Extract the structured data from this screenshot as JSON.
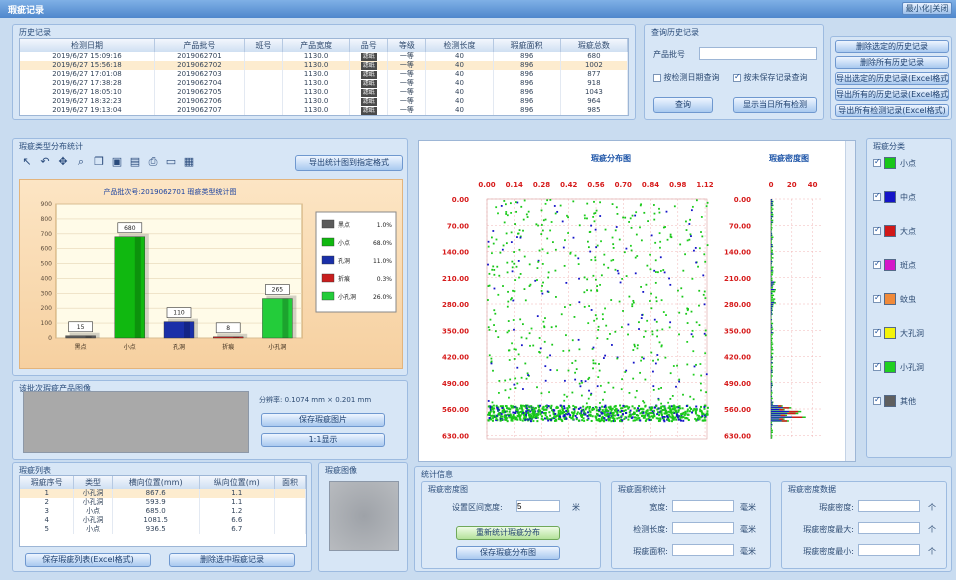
{
  "window": {
    "title": "瑕疵记录",
    "control_label": "最小化|关闭"
  },
  "history": {
    "title": "历史记录",
    "columns": [
      "检测日期",
      "产品批号",
      "班号",
      "产品宽度",
      "品号",
      "等级",
      "检测长度",
      "瑕疵面积",
      "瑕疵总数"
    ],
    "rows": [
      [
        "2019/6/27 15:09:16",
        "2019062701",
        "",
        "1130.0",
        "滤纸",
        "一等",
        "40",
        "896",
        "680"
      ],
      [
        "2019/6/27 15:56:18",
        "2019062702",
        "",
        "1130.0",
        "滤纸",
        "一等",
        "40",
        "896",
        "1002"
      ],
      [
        "2019/6/27 17:01:08",
        "2019062703",
        "",
        "1130.0",
        "滤纸",
        "一等",
        "40",
        "896",
        "877"
      ],
      [
        "2019/6/27 17:38:28",
        "2019062704",
        "",
        "1130.0",
        "滤纸",
        "一等",
        "40",
        "896",
        "918"
      ],
      [
        "2019/6/27 18:05:10",
        "2019062705",
        "",
        "1130.0",
        "滤纸",
        "一等",
        "40",
        "896",
        "1043"
      ],
      [
        "2019/6/27 18:32:23",
        "2019062706",
        "",
        "1130.0",
        "滤纸",
        "一等",
        "40",
        "896",
        "964"
      ],
      [
        "2019/6/27 19:13:04",
        "2019062707",
        "",
        "1130.0",
        "滤纸",
        "一等",
        "40",
        "896",
        "985"
      ]
    ]
  },
  "query": {
    "title": "查询历史记录",
    "batch_label": "产品批号",
    "batch_value": "",
    "check_date_label": "按检测日期查询",
    "check_unsaved_label": "按未保存记录查询",
    "query_button": "查询",
    "today_button": "显示当日所有检测"
  },
  "actions": [
    "删除选定的历史记录",
    "删除所有历史记录",
    "导出选定的历史记录(Excel格式)",
    "导出所有的历史记录(Excel格式)",
    "导出所有检测记录(Excel格式)"
  ],
  "stats": {
    "title": "瑕疵类型分布统计",
    "icons": [
      "pointer-icon",
      "undo-icon",
      "move-icon",
      "zoom-icon",
      "copy-icon",
      "save-icon",
      "grid-icon",
      "print-icon",
      "preview-icon",
      "export-icon"
    ],
    "icon_glyphs": [
      "↖",
      "↶",
      "✥",
      "⌕",
      "❐",
      "▣",
      "▤",
      "⎙",
      "▭",
      "▦"
    ],
    "export_button": "导出统计图到指定格式",
    "chart_title": "产品批次号:2019062701 瑕疵类型统计图",
    "legend_pct": [
      "1.0%",
      "68.0%",
      "11.0%",
      "0.3%",
      "26.0%"
    ]
  },
  "chart_data": [
    {
      "type": "bar",
      "title": "产品批次号:2019062701 瑕疵类型统计图",
      "categories": [
        "黑点",
        "小点",
        "孔洞",
        "折痕",
        "小孔洞"
      ],
      "values": [
        15,
        680,
        110,
        8,
        265
      ],
      "colors": [
        "#5a5a5a",
        "#10b810",
        "#1a2fa8",
        "#c81e1e",
        "#23cc3a"
      ],
      "ylim": [
        0,
        900
      ],
      "yticks": [
        0,
        100,
        200,
        300,
        400,
        500,
        600,
        700,
        800,
        900
      ],
      "data_labels": [
        "15",
        "680",
        "110",
        "8",
        "265"
      ]
    },
    {
      "type": "scatter",
      "title": "瑕疵分布图",
      "xticks": [
        "0.00",
        "0.14",
        "0.28",
        "0.42",
        "0.56",
        "0.70",
        "0.84",
        "0.98",
        "1.12"
      ],
      "yticks": [
        "0.00",
        "70.00",
        "140.00",
        "210.00",
        "280.00",
        "350.00",
        "420.00",
        "490.00",
        "560.00",
        "630.00"
      ],
      "xlim": [
        0,
        1.13
      ],
      "ylim": [
        0,
        640
      ],
      "dense_band": [
        548,
        590
      ]
    },
    {
      "type": "bar",
      "title": "瑕疵密度图",
      "xticks": [
        "0",
        "20",
        "40"
      ],
      "yticks": [
        "0.00",
        "70.00",
        "140.00",
        "210.00",
        "280.00",
        "350.00",
        "420.00",
        "490.00",
        "560.00",
        "630.00"
      ],
      "xlim": [
        0,
        50
      ]
    }
  ],
  "defect_types": {
    "title": "瑕疵分类",
    "items": [
      {
        "name": "小点",
        "color": "#18c618"
      },
      {
        "name": "中点",
        "color": "#1414c8"
      },
      {
        "name": "大点",
        "color": "#d01818"
      },
      {
        "name": "斑点",
        "color": "#d418c8"
      },
      {
        "name": "蚊虫",
        "color": "#f08a3a"
      },
      {
        "name": "大孔洞",
        "color": "#f4f40a"
      },
      {
        "name": "小孔洞",
        "color": "#20d020"
      },
      {
        "name": "其他",
        "color": "#5f5f5f"
      }
    ]
  },
  "product": {
    "title": "该批次瑕疵产品图像",
    "resolution": "分辨率: 0.1074 mm × 0.201 mm",
    "btn_save": "保存瑕疵图片",
    "btn_scale": "1:1显示"
  },
  "defect_list": {
    "title": "瑕疵列表",
    "columns": [
      "瑕疵序号",
      "类型",
      "横向位置(mm)",
      "纵向位置(m)",
      "面积"
    ],
    "rows": [
      [
        "1",
        "小孔洞",
        "867.6",
        "1.1",
        ""
      ],
      [
        "2",
        "小孔洞",
        "593.9",
        "1.1",
        ""
      ],
      [
        "3",
        "小点",
        "685.0",
        "1.2",
        ""
      ],
      [
        "4",
        "小孔洞",
        "1081.5",
        "6.6",
        ""
      ],
      [
        "5",
        "小点",
        "936.5",
        "6.7",
        ""
      ]
    ],
    "btn_export": "保存瑕疵列表(Excel格式)",
    "btn_delete": "删除选中瑕疵记录"
  },
  "defect_image": {
    "title": "瑕疵图像"
  },
  "stats_info": {
    "title": "统计信息",
    "density": {
      "title": "瑕疵密度图",
      "interval_label": "设置区间宽度:",
      "interval_value": "5",
      "interval_unit": "米",
      "btn_display": "重新统计瑕疵分布",
      "btn_save": "保存瑕疵分布图"
    },
    "area": {
      "title": "瑕疵面积统计",
      "rows": [
        {
          "label": "宽度:",
          "unit": "毫米"
        },
        {
          "label": "检测长度:",
          "unit": "毫米"
        },
        {
          "label": "瑕疵面积:",
          "unit": "毫米"
        }
      ]
    },
    "count": {
      "title": "瑕疵密度数据",
      "rows": [
        {
          "label": "瑕疵密度:",
          "unit": "个"
        },
        {
          "label": "瑕疵密度最大:",
          "unit": "个"
        },
        {
          "label": "瑕疵密度最小:",
          "unit": "个"
        }
      ]
    }
  }
}
